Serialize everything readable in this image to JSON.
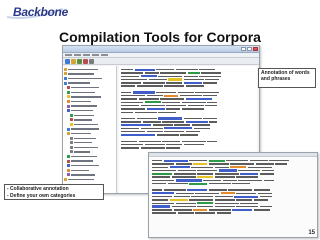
{
  "logo": {
    "text": "Backbone"
  },
  "title": "Compilation Tools for Corpora",
  "callout": {
    "text": "Annotation of words and phrases"
  },
  "bullets": [
    "- Collaborative annotation",
    "- Define your own categories"
  ],
  "page_number": "15",
  "colors": {
    "highlight_blue": "#3f5ec9",
    "highlight_green": "#2e9a47",
    "highlight_yellow": "#e6c224",
    "highlight_orange": "#e38a2d"
  }
}
